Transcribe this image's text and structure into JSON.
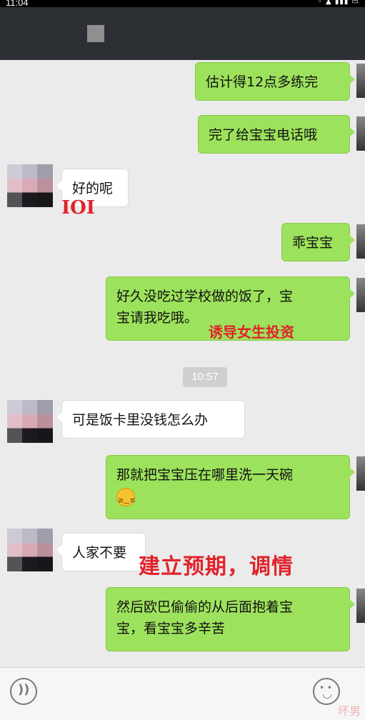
{
  "status_bar": {
    "time": "11:04",
    "icons": "◦ ▲ ▮▮▮ ▭"
  },
  "messages": [
    {
      "side": "right",
      "text": "估计得12点多练完"
    },
    {
      "side": "right",
      "text": "完了给宝宝电话哦"
    },
    {
      "side": "left",
      "text": "好的呢"
    },
    {
      "side": "right",
      "text": "乖宝宝"
    },
    {
      "side": "right",
      "lines": [
        "好久没吃过学校做的饭了，宝",
        "宝请我吃哦。"
      ]
    },
    {
      "side": "left",
      "text": "可是饭卡里没钱怎么办"
    },
    {
      "side": "right",
      "lines": [
        "那就把宝宝压在哪里洗一天碗"
      ],
      "emoji": "grin-emoji"
    },
    {
      "side": "left",
      "text": "人家不要"
    },
    {
      "side": "right",
      "lines": [
        "然后欧巴偷偷的从后面抱着宝",
        "宝，看宝宝多辛苦"
      ]
    }
  ],
  "timestamp": "10:57",
  "annotations": {
    "ioi": "IOI",
    "induce": "诱导女生投资",
    "build": "建立预期，调情"
  },
  "watermark": "坏男",
  "colors": {
    "sent_bubble": "#9de25c",
    "received_bubble": "#ffffff",
    "annotation": "#e0232b",
    "header": "#2c2f34"
  }
}
